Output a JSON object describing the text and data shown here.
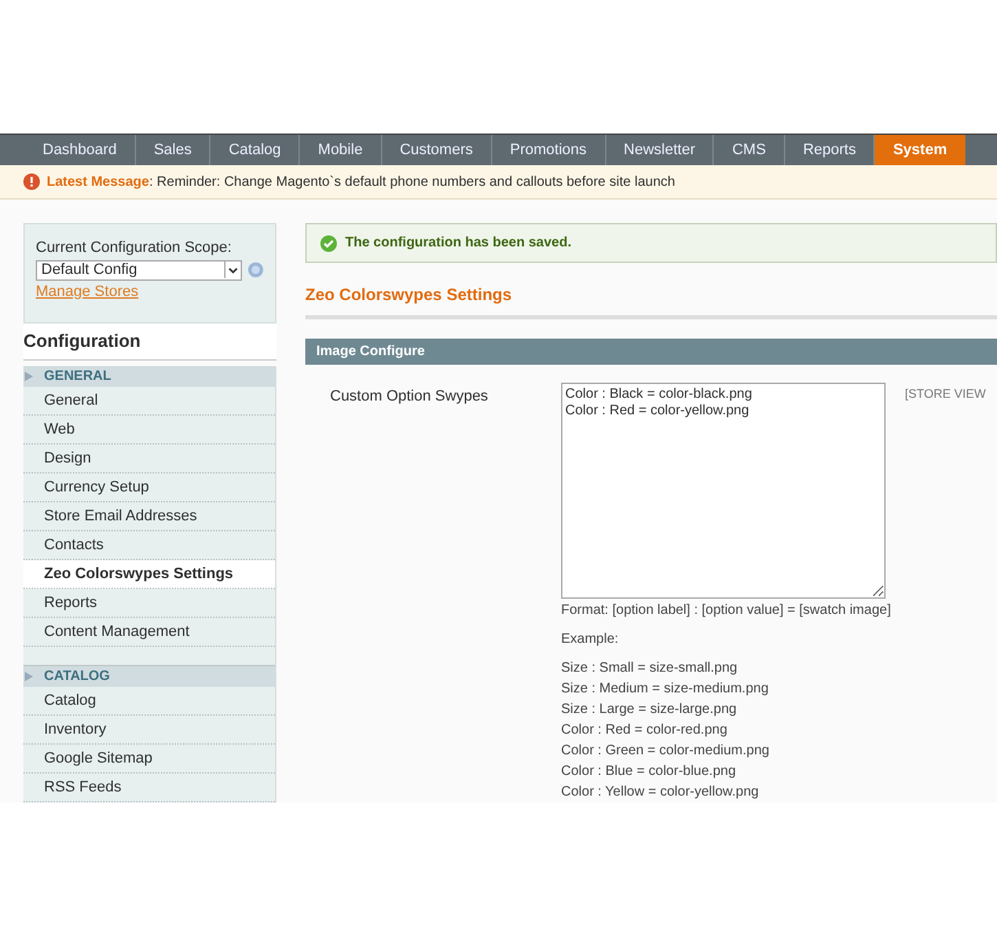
{
  "nav": [
    {
      "label": "Dashboard",
      "selected": false
    },
    {
      "label": "Sales",
      "selected": false
    },
    {
      "label": "Catalog",
      "selected": false
    },
    {
      "label": "Mobile",
      "selected": false
    },
    {
      "label": "Customers",
      "selected": false
    },
    {
      "label": "Promotions",
      "selected": false
    },
    {
      "label": "Newsletter",
      "selected": false
    },
    {
      "label": "CMS",
      "selected": false
    },
    {
      "label": "Reports",
      "selected": false
    },
    {
      "label": "System",
      "selected": true
    }
  ],
  "notice": {
    "text": "**Latest Message**: Reminder: Change Magento`s default phone numbers and callouts before site launch"
  },
  "scope": {
    "label": "Current Configuration Scope:",
    "value": "Default Config",
    "link": "Manage Stores"
  },
  "sidebar": {
    "title": "Configuration",
    "sections": [
      {
        "label": "GENERAL",
        "items": [
          {
            "label": "General",
            "selected": false
          },
          {
            "label": "Web",
            "selected": false
          },
          {
            "label": "Design",
            "selected": false
          },
          {
            "label": "Currency Setup",
            "selected": false
          },
          {
            "label": "Store Email Addresses",
            "selected": false
          },
          {
            "label": "Contacts",
            "selected": false
          },
          {
            "label": "Zeo Colorswypes Settings",
            "selected": true
          },
          {
            "label": "Reports",
            "selected": false
          },
          {
            "label": "Content Management",
            "selected": false
          }
        ]
      },
      {
        "label": "CATALOG",
        "items": [
          {
            "label": "Catalog",
            "selected": false
          },
          {
            "label": "Inventory",
            "selected": false
          },
          {
            "label": "Google Sitemap",
            "selected": false
          },
          {
            "label": "RSS Feeds",
            "selected": false
          }
        ]
      }
    ]
  },
  "success": "The configuration has been saved.",
  "page_title": "Zeo Colorswypes Settings",
  "fieldset": {
    "title": "Image Configure",
    "field": {
      "label": "Custom Option Swypes",
      "value": "Color : Black = color-black.png\nColor : Red = color-yellow.png",
      "scope": "[STORE VIEW",
      "format": "Format: [option label] : [option value] = [swatch image]",
      "example_label": "Example:",
      "examples": [
        "Size : Small = size-small.png",
        "Size : Medium = size-medium.png",
        "Size : Large = size-large.png",
        "Color : Red = color-red.png",
        "Color : Green = color-medium.png",
        "Color : Blue = color-blue.png",
        "Color : Yellow = color-yellow.png"
      ]
    }
  }
}
